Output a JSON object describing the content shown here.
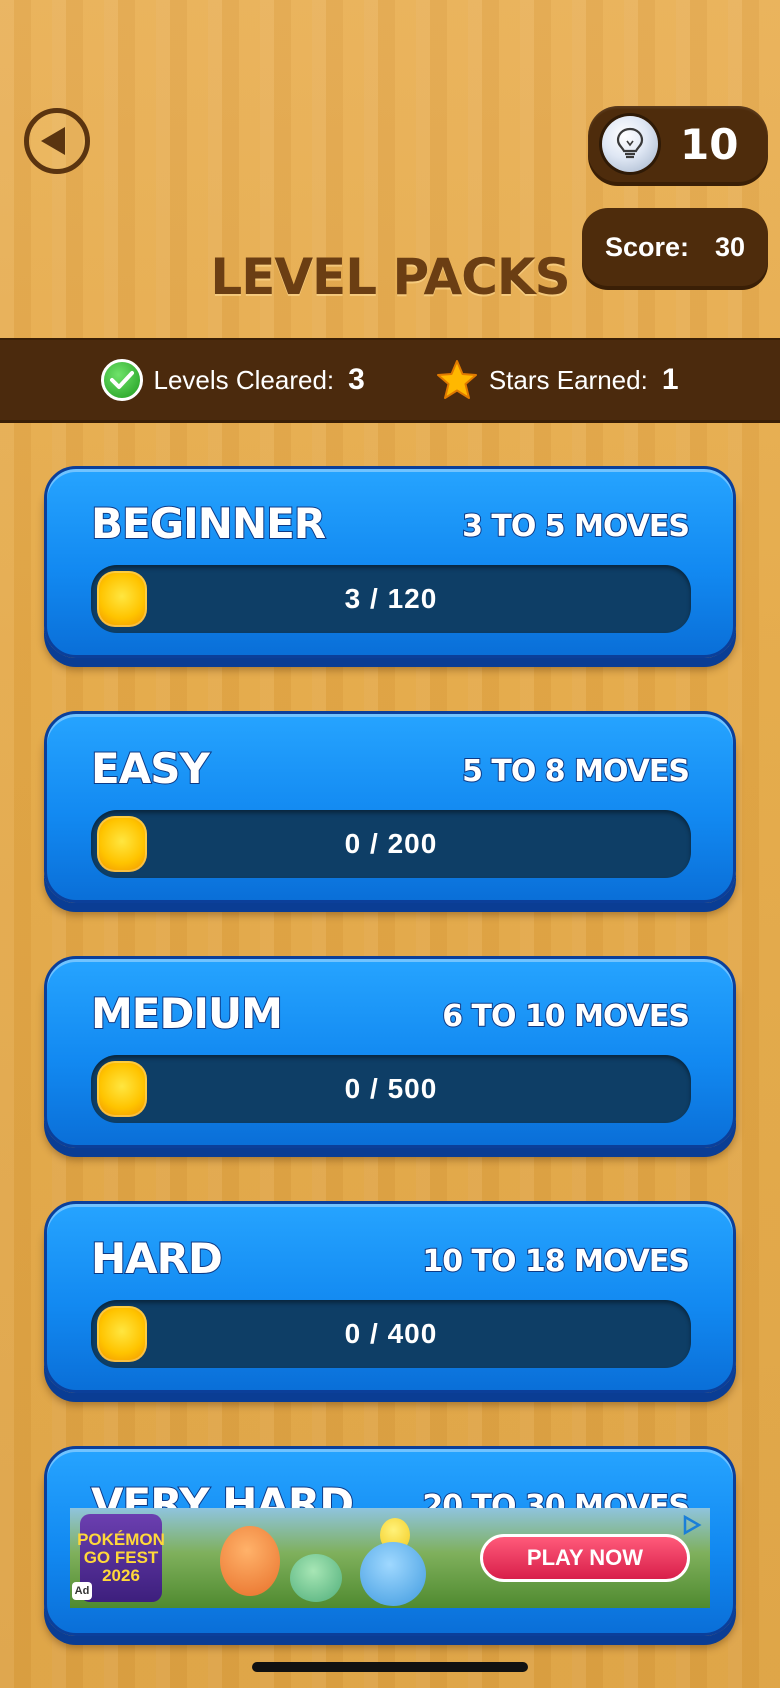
{
  "header": {
    "title": "LEVEL PACKS",
    "hints": "10",
    "score_label": "Score:",
    "score_value": "30"
  },
  "stats": {
    "levels_cleared_label": "Levels Cleared:",
    "levels_cleared_value": "3",
    "stars_earned_label": "Stars Earned:",
    "stars_earned_value": "1"
  },
  "packs": [
    {
      "name": "BEGINNER",
      "moves": "3 TO 5 MOVES",
      "progress": "3 / 120",
      "fraction": 0.025
    },
    {
      "name": "EASY",
      "moves": "5 TO 8 MOVES",
      "progress": "0 / 200",
      "fraction": 0
    },
    {
      "name": "MEDIUM",
      "moves": "6 TO 10 MOVES",
      "progress": "0 / 500",
      "fraction": 0
    },
    {
      "name": "HARD",
      "moves": "10 TO 18 MOVES",
      "progress": "0 / 400",
      "fraction": 0
    },
    {
      "name": "VERY HARD",
      "moves": "20 TO 30 MOVES",
      "progress": "",
      "fraction": 0
    }
  ],
  "ad": {
    "brand": "POKÉMON GO FEST 2026",
    "badge": "Ad",
    "cta": "PLAY NOW"
  },
  "colors": {
    "wood": "#e4a949",
    "dark_brown": "#4b2a0d",
    "pack_blue": "#1289f1",
    "track": "#0e3e66",
    "fill_yellow": "#ffc400"
  },
  "icons": {
    "back": "back-arrow-icon",
    "hint": "lightbulb-icon",
    "cleared": "check-circle-icon",
    "stars": "star-icon",
    "ad_play": "play-triangle-icon"
  }
}
